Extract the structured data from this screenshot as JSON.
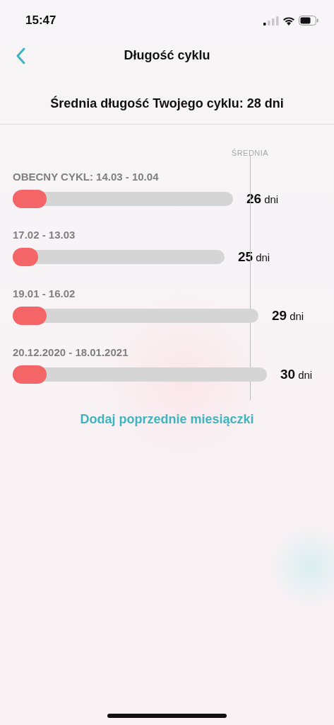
{
  "status_bar": {
    "time": "15:47"
  },
  "nav": {
    "title": "Długość cyklu"
  },
  "summary": "Średnia długość Twojego cyklu: 28 dni",
  "average_label": "ŚREDNIA",
  "cycles": [
    {
      "period": "OBECNY CYKL: 14.03 - 10.04",
      "days": "26",
      "unit": "dni",
      "level": 0.154
    },
    {
      "period": "17.02 - 13.03",
      "days": "25",
      "unit": "dni",
      "level": 0.12
    },
    {
      "period": "19.01 - 16.02",
      "days": "29",
      "unit": "dni",
      "level": 0.138
    },
    {
      "period": "20.12.2020 - 18.01.2021",
      "days": "30",
      "unit": "dni",
      "level": 0.133
    }
  ],
  "link": "Dodaj poprzednie miesiączki"
}
